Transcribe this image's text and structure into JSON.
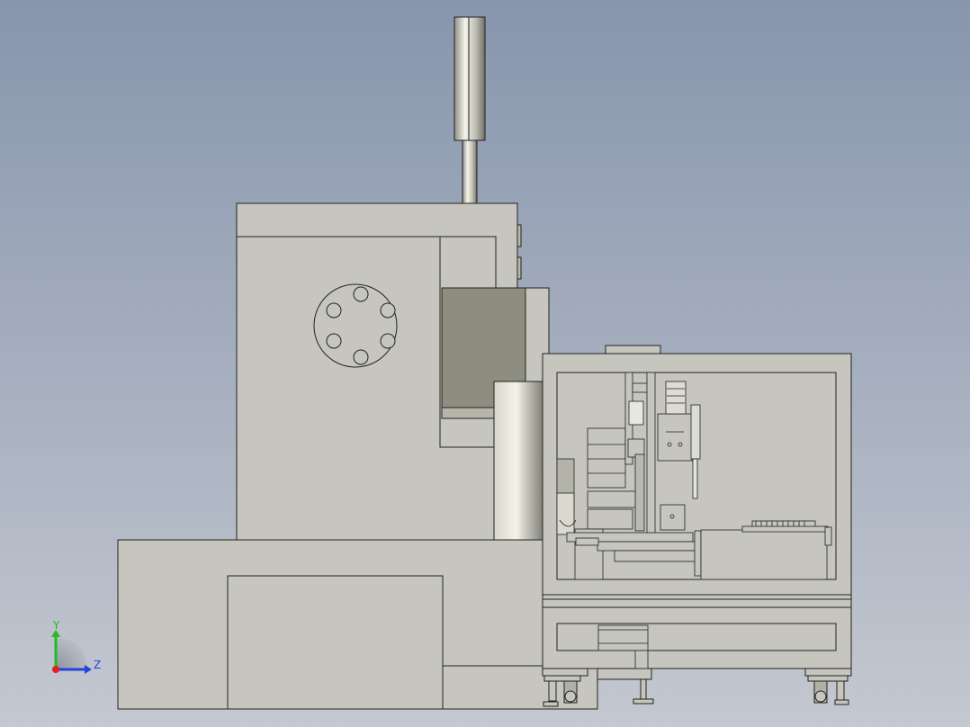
{
  "viewport": {
    "background_top": "#8795ad",
    "background_bottom": "#c4c8d0"
  },
  "model": {
    "body_fill": "#c6c6be",
    "body_stroke": "#222222",
    "window_fill": "#8e8e80"
  },
  "triad": {
    "y_label": "Y",
    "z_label": "Z",
    "y_color": "#22bb22",
    "z_color": "#2244dd",
    "x_color": "#dd2222"
  }
}
